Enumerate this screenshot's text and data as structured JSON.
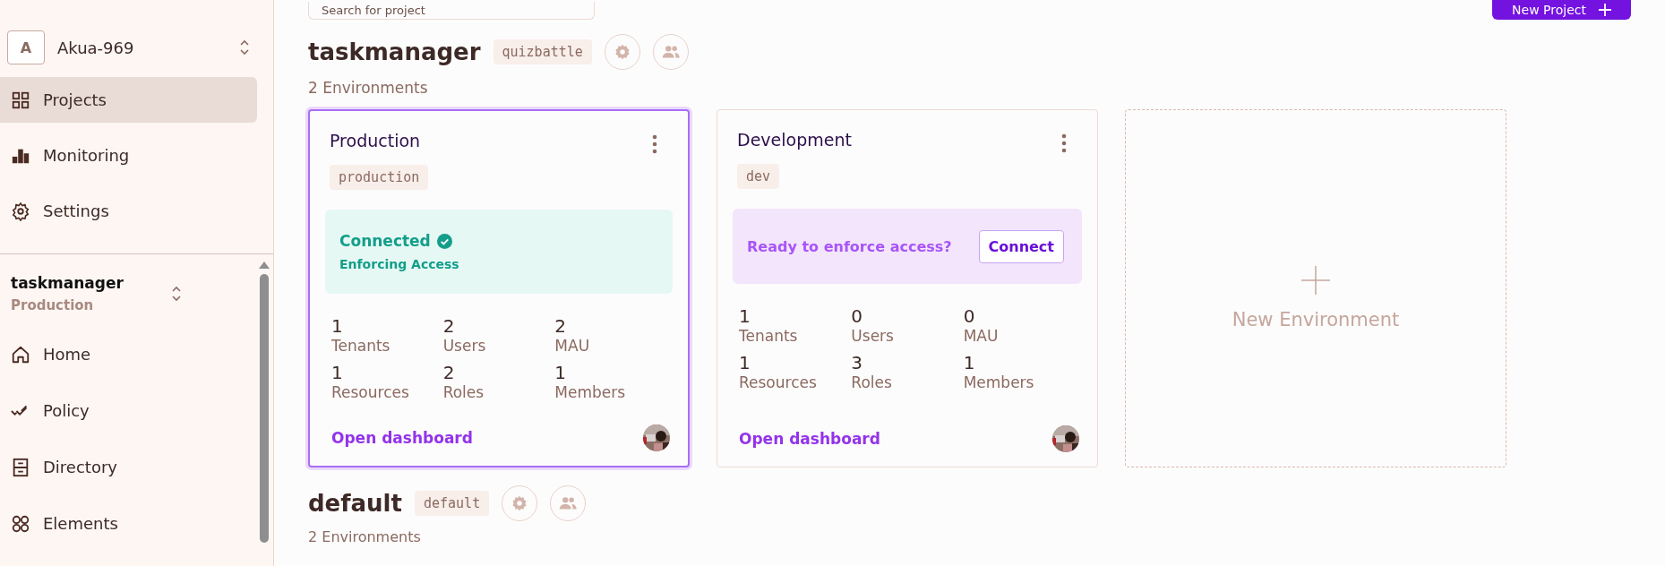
{
  "top_bar": {
    "search": {
      "placeholder": "Search for project"
    },
    "new_project_button": {
      "label": "New Project"
    }
  },
  "sidebar": {
    "org": {
      "initial": "A",
      "name": "Akua-969"
    },
    "nav": [
      {
        "label": "Projects",
        "selected": true
      },
      {
        "label": "Monitoring",
        "selected": false
      },
      {
        "label": "Settings",
        "selected": false
      }
    ],
    "project_switcher": {
      "name": "taskmanager",
      "environment": "Production"
    },
    "project_nav": [
      {
        "label": "Home",
        "selected": false
      },
      {
        "label": "Policy",
        "selected": false
      },
      {
        "label": "Directory",
        "selected": false
      },
      {
        "label": "Elements",
        "selected": false
      }
    ]
  },
  "projects": [
    {
      "name": "taskmanager",
      "key": "quizbattle",
      "environments_count": "2 Environments",
      "environments": [
        {
          "name": "Production",
          "key": "production",
          "selected": true,
          "status": {
            "kind": "connected",
            "title": "Connected",
            "subtitle": "Enforcing Access"
          },
          "stats": [
            {
              "value": "1",
              "label": "Tenants"
            },
            {
              "value": "2",
              "label": "Users"
            },
            {
              "value": "2",
              "label": "MAU"
            },
            {
              "value": "1",
              "label": "Resources"
            },
            {
              "value": "2",
              "label": "Roles"
            },
            {
              "value": "1",
              "label": "Members"
            }
          ],
          "link": "Open dashboard"
        },
        {
          "name": "Development",
          "key": "dev",
          "selected": false,
          "status": {
            "kind": "prompt",
            "text": "Ready to enforce access?",
            "button": "Connect"
          },
          "stats": [
            {
              "value": "1",
              "label": "Tenants"
            },
            {
              "value": "0",
              "label": "Users"
            },
            {
              "value": "0",
              "label": "MAU"
            },
            {
              "value": "1",
              "label": "Resources"
            },
            {
              "value": "3",
              "label": "Roles"
            },
            {
              "value": "1",
              "label": "Members"
            }
          ],
          "link": "Open dashboard"
        }
      ],
      "new_environment": "New Environment"
    },
    {
      "name": "default",
      "key": "default",
      "environments_count": "2 Environments"
    }
  ]
}
